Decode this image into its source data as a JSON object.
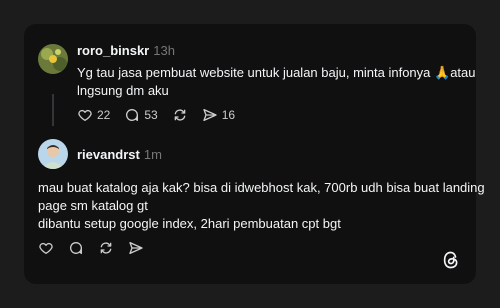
{
  "colors": {
    "background": "#1c1c1c",
    "card": "#101010",
    "text": "#f3f5f7",
    "muted": "#777777",
    "icon": "#cccccc"
  },
  "posts": [
    {
      "username": "roro_binskr",
      "time": "13h",
      "lines": [
        "Yg tau jasa pembuat website untuk jualan baju, minta infonya 🙏atau",
        "lngsung dm aku"
      ],
      "likes": "22",
      "comments": "53",
      "shares": "16"
    },
    {
      "username": "rievandrst",
      "time": "1m",
      "lines": [
        "mau buat katalog aja kak? bisa di idwebhost kak, 700rb udh bisa buat landing",
        "page sm katalog gt",
        "dibantu setup google index, 2hari pembuatan cpt bgt"
      ]
    }
  ],
  "icons": {
    "like": "heart-icon",
    "comment": "comment-icon",
    "repost": "repost-icon",
    "share": "send-icon",
    "brand": "threads-logo-icon"
  }
}
